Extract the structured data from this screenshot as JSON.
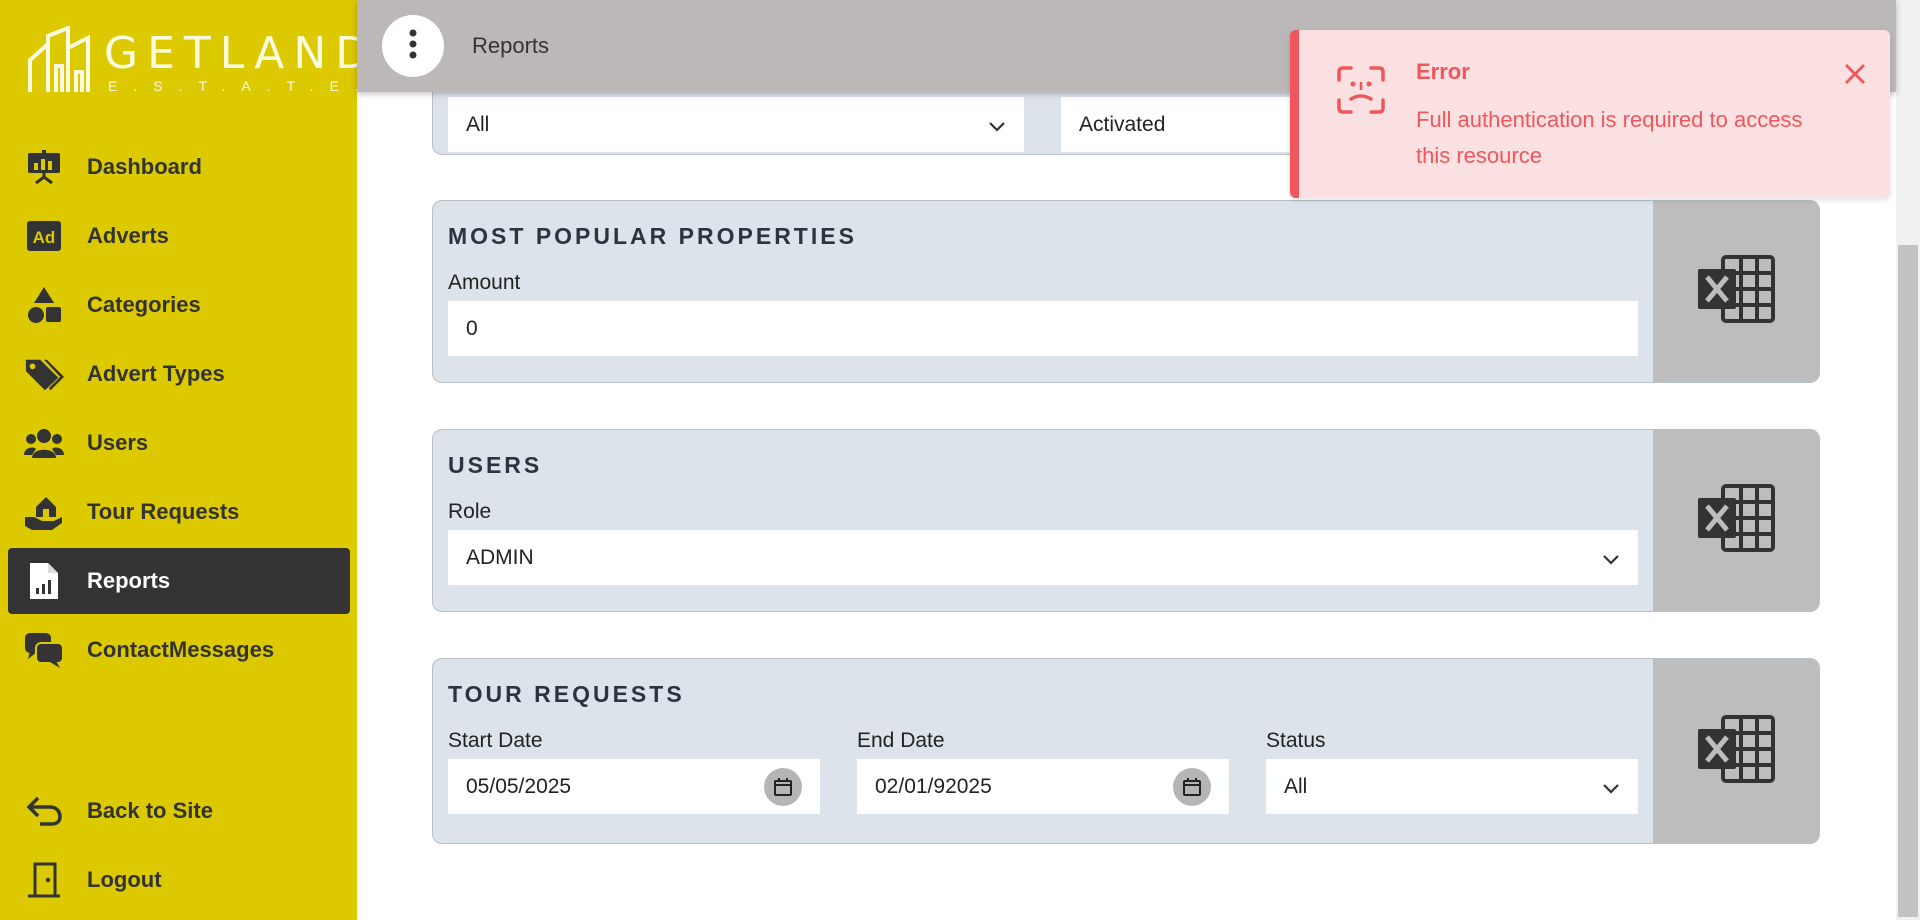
{
  "sidebar": {
    "logo": {
      "main": "GETLAND",
      "sub": "E.S.T.A.T.E."
    },
    "items": [
      {
        "label": "Dashboard",
        "icon": "presentation-board-icon"
      },
      {
        "label": "Adverts",
        "icon": "ad-icon"
      },
      {
        "label": "Categories",
        "icon": "shapes-icon"
      },
      {
        "label": "Advert Types",
        "icon": "tags-icon"
      },
      {
        "label": "Users",
        "icon": "users-icon"
      },
      {
        "label": "Tour Requests",
        "icon": "hand-house-icon"
      },
      {
        "label": "Reports",
        "icon": "file-chart-icon",
        "active": true
      },
      {
        "label": "ContactMessages",
        "icon": "chat-bubbles-icon"
      }
    ],
    "bottom": [
      {
        "label": "Back to Site",
        "icon": "back-arrow-icon"
      },
      {
        "label": "Logout",
        "icon": "door-icon"
      }
    ]
  },
  "topbar": {
    "breadcrumb": "Reports",
    "menu_icon": "kebab-menu-icon"
  },
  "adverts_partial": {
    "first_select": "All",
    "second_select": "Activated"
  },
  "popular_properties": {
    "title": "MOST POPULAR PROPERTIES",
    "amount_label": "Amount",
    "amount_value": "0"
  },
  "users": {
    "title": "USERS",
    "role_label": "Role",
    "role_value": "ADMIN"
  },
  "tour_requests": {
    "title": "TOUR REQUESTS",
    "start_label": "Start Date",
    "start_value": "05/05/2025",
    "end_label": "End Date",
    "end_value": "02/01/92025",
    "status_label": "Status",
    "status_value": "All"
  },
  "toast": {
    "title": "Error",
    "message": "Full authentication is required to access this resource",
    "color": "#f0565b"
  },
  "colors": {
    "sidebar": "#dcc900",
    "active": "#333333",
    "card": "#dde3ea",
    "topbar": "#bdb8b8"
  }
}
